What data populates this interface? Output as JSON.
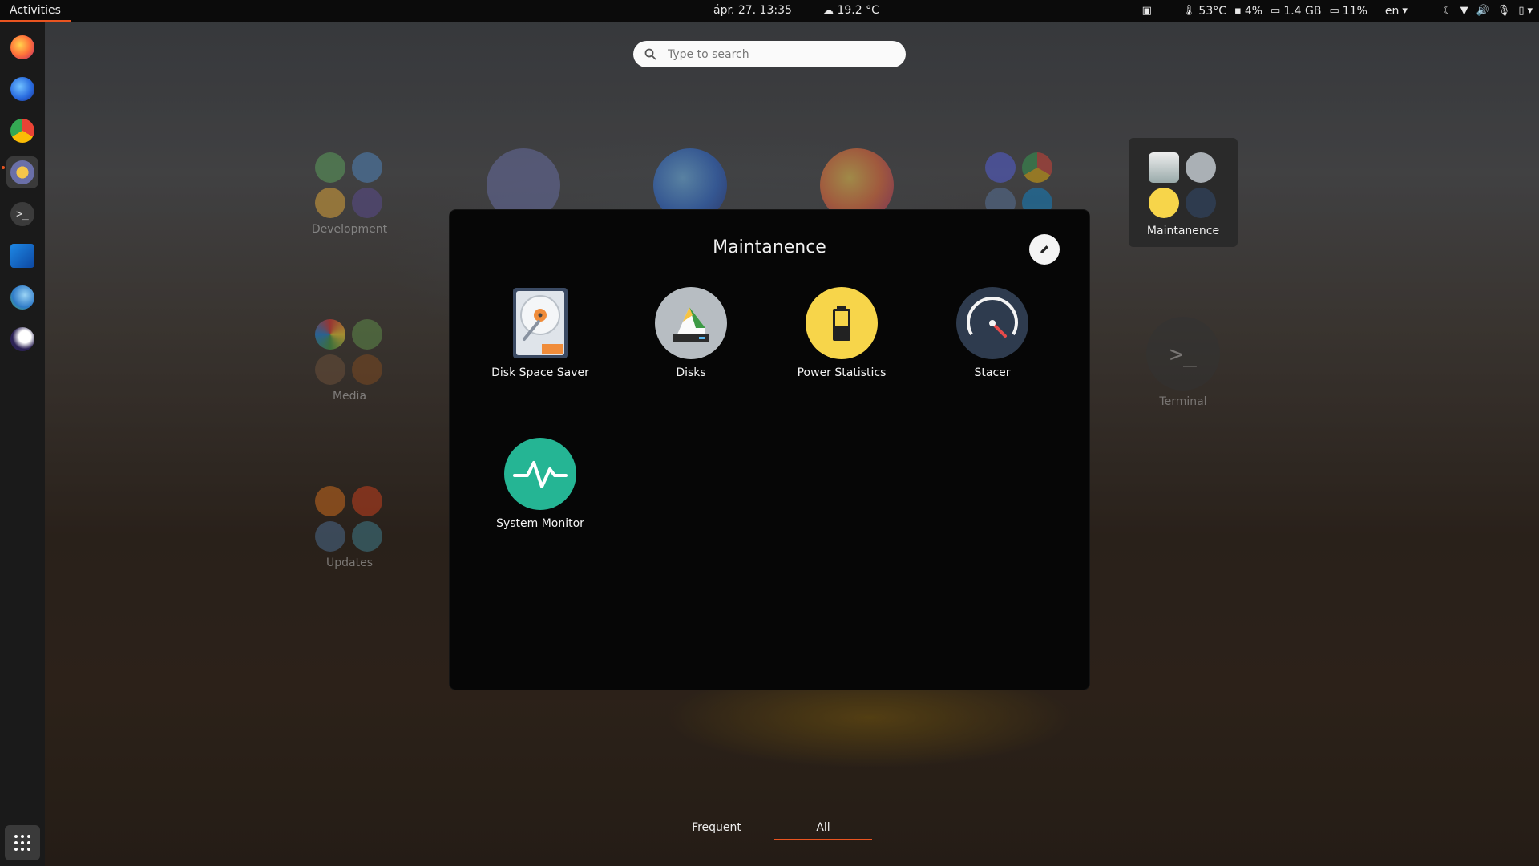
{
  "topbar": {
    "activities": "Activities",
    "clock": "ápr. 27.  13:35",
    "weather": "19.2 °C",
    "temp": "53°C",
    "disk": "4%",
    "mem": "1.4 GB",
    "swap": "11%",
    "lang": "en"
  },
  "search": {
    "placeholder": "Type to search"
  },
  "background": {
    "folders": [
      {
        "label": "Development"
      },
      {
        "label": "Media"
      },
      {
        "label": "Updates"
      },
      {
        "label": "Maintanence"
      },
      {
        "label": "Terminal"
      }
    ]
  },
  "popup": {
    "title": "Maintanence",
    "apps": [
      {
        "label": "Disk Space Saver"
      },
      {
        "label": "Disks"
      },
      {
        "label": "Power Statistics"
      },
      {
        "label": "Stacer"
      },
      {
        "label": "System Monitor"
      }
    ]
  },
  "tabs": [
    {
      "label": "Frequent"
    },
    {
      "label": "All"
    }
  ],
  "colors": {
    "accent": "#e95420"
  }
}
